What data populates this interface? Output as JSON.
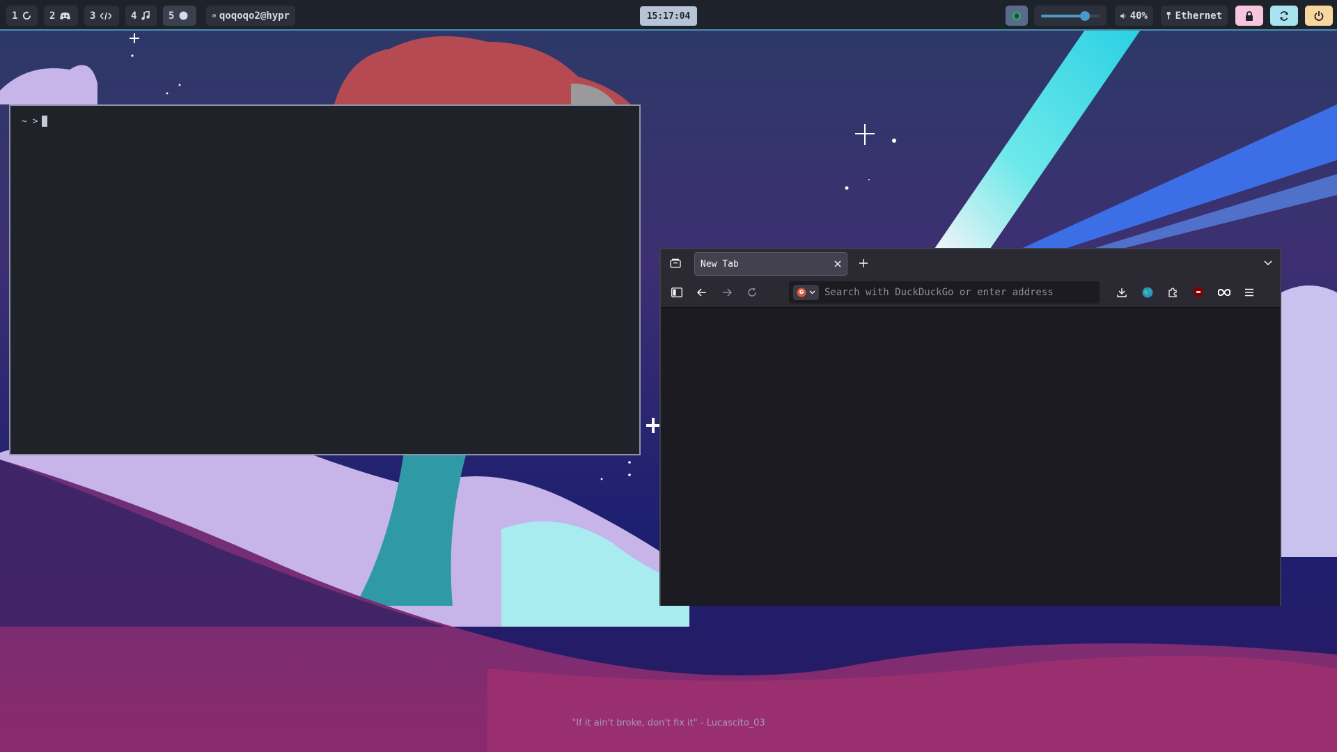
{
  "workspaces": [
    {
      "num": "1",
      "icon": "power-cycle-icon"
    },
    {
      "num": "2",
      "icon": "discord-icon"
    },
    {
      "num": "3",
      "icon": "code-icon"
    },
    {
      "num": "4",
      "icon": "music-note-icon"
    },
    {
      "num": "5",
      "icon": "circle-icon"
    }
  ],
  "user": {
    "label": "qoqoqo2@hypr",
    "icon": "gear-icon"
  },
  "clock": "15:17:04",
  "volume": {
    "label": "40%",
    "level": 0.75
  },
  "network": {
    "label": "Ethernet"
  },
  "colors": {
    "bar_bg": "#1e222a",
    "accent_blue": "#4a8db0",
    "lock_btn": "#f5c6dc",
    "refresh_btn": "#a8e3f0",
    "power_btn": "#f8d6a0"
  },
  "terminal": {
    "prompt": "~ >"
  },
  "browser": {
    "tab_title": "New Tab",
    "search_placeholder": "Search with DuckDuckGo or enter address"
  },
  "wallpaper_quote": "\"If it ain't broke, don't fix it\" - Lucascito_03"
}
